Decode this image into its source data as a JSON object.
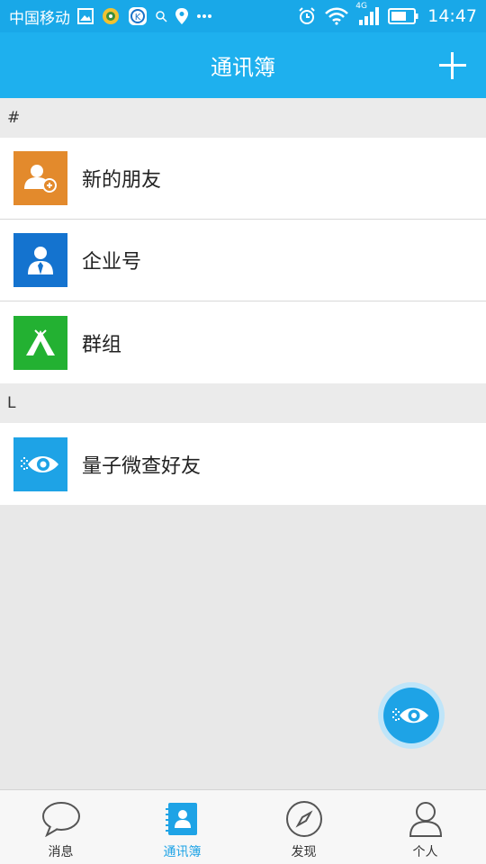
{
  "status_bar": {
    "carrier": "中国移动",
    "network": "4G",
    "time": "14:47"
  },
  "header": {
    "title": "通讯簿",
    "add_icon": "plus-icon"
  },
  "sections": [
    {
      "index": "#",
      "items": [
        {
          "label": "新的朋友",
          "icon": "add-person-icon",
          "color": "#e38a2c"
        },
        {
          "label": "企业号",
          "icon": "business-person-icon",
          "color": "#1473cf"
        },
        {
          "label": "群组",
          "icon": "tent-icon",
          "color": "#23b132"
        }
      ]
    },
    {
      "index": "L",
      "items": [
        {
          "label": "量子微查好友",
          "icon": "quantum-eye-icon",
          "color": "#1ea3e6"
        }
      ]
    }
  ],
  "bottom_nav": [
    {
      "label": "消息",
      "icon": "chat-bubble-icon",
      "active": false
    },
    {
      "label": "通讯簿",
      "icon": "contacts-book-icon",
      "active": true
    },
    {
      "label": "发现",
      "icon": "compass-icon",
      "active": false
    },
    {
      "label": "个人",
      "icon": "person-icon",
      "active": false
    }
  ],
  "colors": {
    "accent": "#1eb0ee",
    "nav_active": "#1ea3e6"
  }
}
